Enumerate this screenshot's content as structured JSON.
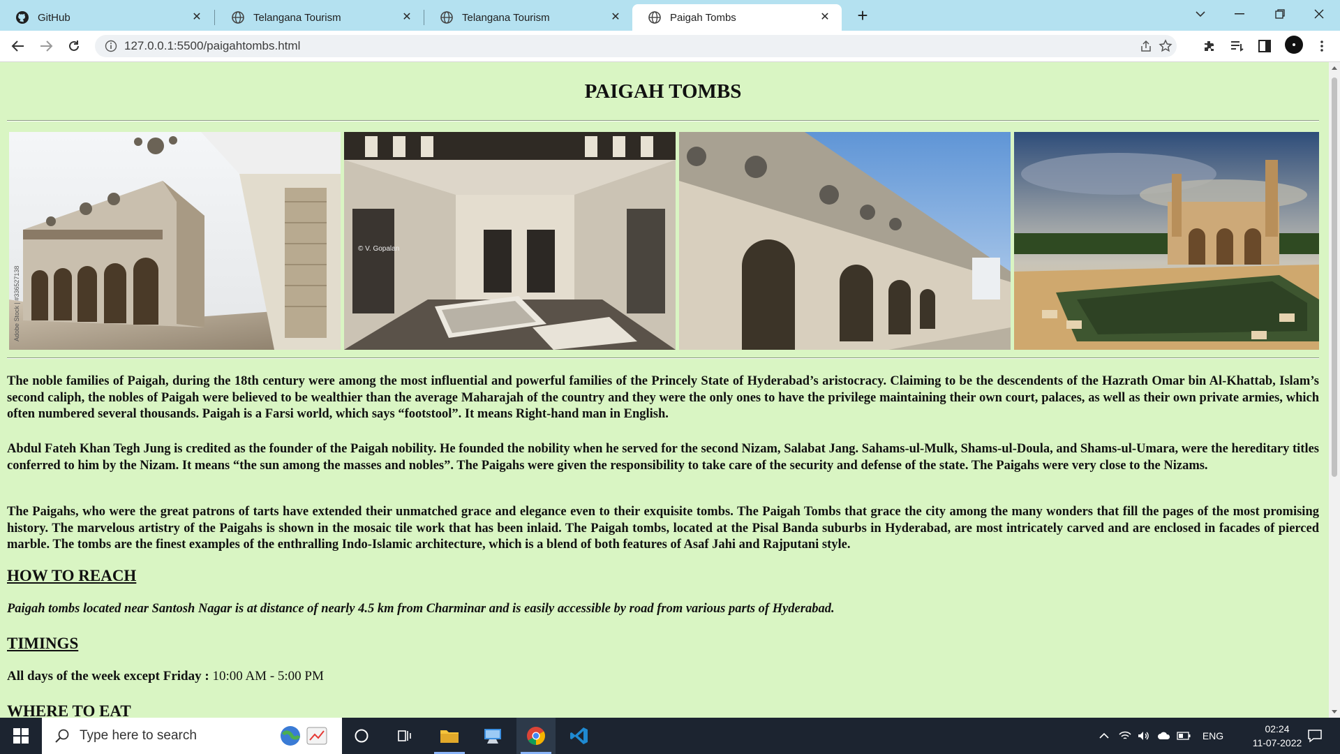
{
  "browser": {
    "tabs": [
      {
        "title": "GitHub",
        "icon": "github-icon",
        "active": false
      },
      {
        "title": "Telangana Tourism",
        "icon": "globe-icon",
        "active": false
      },
      {
        "title": "Telangana Tourism",
        "icon": "globe-icon",
        "active": false
      },
      {
        "title": "Paigah Tombs",
        "icon": "globe-icon",
        "active": true
      }
    ],
    "url": "127.0.0.1:5500/paigahtombs.html",
    "colors": {
      "tabstrip": "#b4e1f0",
      "page_background": "#d9f5c3"
    }
  },
  "page": {
    "title": "PAIGAH TOMBS",
    "gallery": [
      {
        "icon": "tomb-corner-photo",
        "watermark": "Adobe Stock | #336527138"
      },
      {
        "icon": "tomb-interior-photo",
        "watermark": "© V. Gopalan"
      },
      {
        "icon": "tomb-arcade-photo",
        "watermark": ""
      },
      {
        "icon": "tomb-pond-photo",
        "watermark": ""
      }
    ],
    "paragraphs": [
      "The noble families of Paigah, during the 18th century were among the most influential and powerful families of the Princely State of Hyderabad’s aristocracy. Claiming to be the descendents of the Hazrath Omar bin Al-Khattab, Islam’s second caliph, the nobles of Paigah were believed to be wealthier than the average Maharajah of the country and they were the only ones to have the privilege maintaining their own court, palaces, as well as their own private armies, which often numbered several thousands. Paigah is a Farsi world, which says “footstool”. It means Right-hand man in English.",
      "Abdul Fateh Khan Tegh Jung is credited as the founder of the Paigah nobility. He founded the nobility when he served for the second Nizam, Salabat Jang. Sahams-ul-Mulk, Shams-ul-Doula, and Shams-ul-Umara, were the hereditary titles conferred to him by the Nizam. It means “the sun among the masses and nobles”. The Paigahs were given the responsibility to take care of the security and defense of the state. The Paigahs were very close to the Nizams.",
      "The Paigahs, who were the great patrons of tarts have extended their unmatched grace and elegance even to their exquisite tombs. The Paigah Tombs that grace the city among the many wonders that fill the pages of the most promising history. The marvelous artistry of the Paigahs is shown in the mosaic tile work that has been inlaid. The Paigah tombs, located at the Pisal Banda suburbs in Hyderabad, are most intricately carved and are enclosed in facades of pierced marble. The tombs are the finest examples of the enthralling Indo-Islamic architecture, which is a blend of both features of Asaf Jahi and Rajputani style."
    ],
    "how_to_reach": {
      "heading": "HOW TO REACH",
      "text": "Paigah tombs located near Santosh Nagar is at distance of nearly 4.5 km from Charminar and is easily accessible by road from various parts of Hyderabad."
    },
    "timings": {
      "heading": "TIMINGS",
      "label": "All days of the week except Friday :",
      "value": " 10:00 AM - 5:00 PM"
    },
    "where_to_eat": {
      "heading": "WHERE TO EAT"
    }
  },
  "taskbar": {
    "search_placeholder": "Type here to search",
    "language": "ENG",
    "time": "02:24",
    "date": "11-07-2022",
    "apps": [
      "task-view-icon",
      "cortana-icon",
      "file-explorer-icon",
      "remote-desktop-icon",
      "chrome-icon",
      "vscode-icon"
    ]
  }
}
